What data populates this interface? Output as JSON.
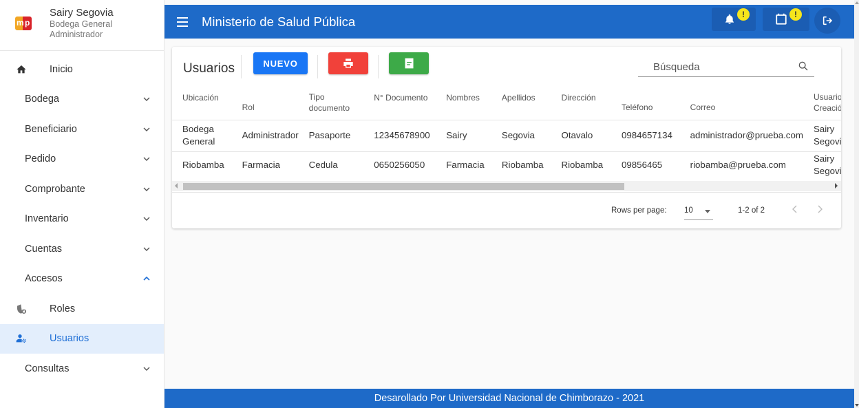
{
  "profile": {
    "name": "Sairy Segovia",
    "location": "Bodega General",
    "role": "Administrador",
    "logo_left": "m",
    "logo_right": "p"
  },
  "sidebar": {
    "items": [
      {
        "label": "Inicio",
        "icon": "home-icon"
      },
      {
        "label": "Bodega",
        "expanded": false
      },
      {
        "label": "Beneficiario",
        "expanded": false
      },
      {
        "label": "Pedido",
        "expanded": false
      },
      {
        "label": "Comprobante",
        "expanded": false
      },
      {
        "label": "Inventario",
        "expanded": false
      },
      {
        "label": "Cuentas",
        "expanded": false
      },
      {
        "label": "Accesos",
        "expanded": true
      },
      {
        "label": "Roles",
        "icon": "shield-lock-icon"
      },
      {
        "label": "Usuarios",
        "icon": "user-gear-icon",
        "active": true
      },
      {
        "label": "Consultas",
        "expanded": false
      }
    ]
  },
  "header": {
    "title": "Ministerio de Salud Pública",
    "notification_badge": "!",
    "calendar_badge": "!"
  },
  "card": {
    "title": "Usuarios",
    "new_button": "NUEVO",
    "search_placeholder": "Búsqueda",
    "columns": [
      "Ubicación",
      "Rol",
      "Tipo documento",
      "N° Documento",
      "Nombres",
      "Apellidos",
      "Dirección",
      "Teléfono",
      "Correo",
      "Usuario Creación"
    ],
    "rows": [
      [
        "Bodega General",
        "Administrador",
        "Pasaporte",
        "12345678900",
        "Sairy",
        "Segovia",
        "Otavalo",
        "0984657134",
        "administrador@prueba.com",
        "Sairy Segovia"
      ],
      [
        "Riobamba",
        "Farmacia",
        "Cedula",
        "0650256050",
        "Farmacia",
        "Riobamba",
        "Riobamba",
        "09856465",
        "riobamba@prueba.com",
        "Sairy Segovia"
      ]
    ],
    "pagination": {
      "rows_per_page_label": "Rows per page:",
      "rows_per_page": "10",
      "range": "1-2 of 2"
    }
  },
  "footer": {
    "text": "Desarollado Por Universidad Nacional de Chimborazo - 2021"
  },
  "colors": {
    "primary": "#1e6ac8",
    "new_button": "#1976f5",
    "print_button": "#f1413a",
    "export_button": "#3daa48",
    "badge": "#f6e51c",
    "active_item_bg": "#e3eefc"
  }
}
